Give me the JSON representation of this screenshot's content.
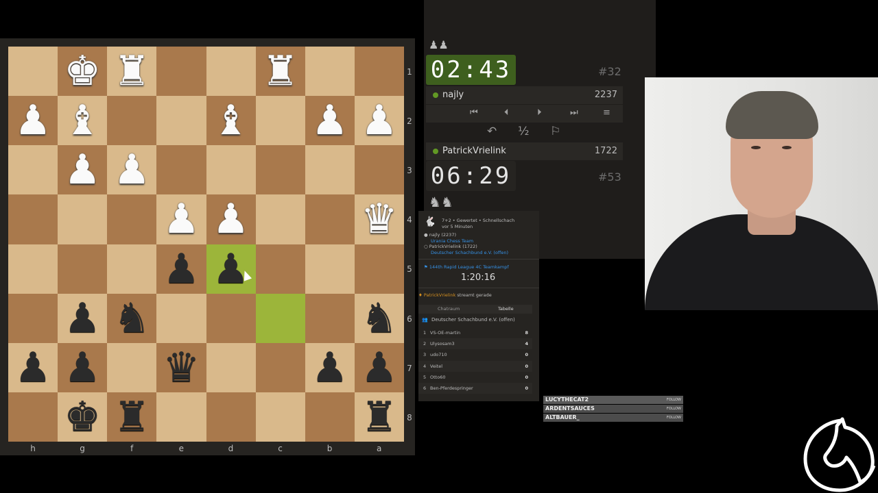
{
  "board": {
    "ranks": [
      "1",
      "2",
      "3",
      "4",
      "5",
      "6",
      "7",
      "8"
    ],
    "files": [
      "h",
      "g",
      "f",
      "e",
      "d",
      "c",
      "b",
      "a"
    ],
    "squares": [
      [
        "",
        "♚",
        "♜",
        "",
        "",
        "♜",
        "",
        ""
      ],
      [
        "♟",
        "♝",
        "",
        "",
        "♝",
        "",
        "♟",
        "♟"
      ],
      [
        "",
        "♟",
        "♟",
        "",
        "",
        "",
        "",
        ""
      ],
      [
        "",
        "",
        "",
        "♟",
        "♟",
        "",
        "",
        "♛"
      ],
      [
        "",
        "",
        "",
        "♟",
        "♟",
        "",
        "",
        ""
      ],
      [
        "",
        "♟",
        "♞",
        "",
        "",
        "",
        "",
        "♞"
      ],
      [
        "♟",
        "♟",
        "",
        "♛",
        "",
        "",
        "♟",
        "♟"
      ],
      [
        "",
        "♚",
        "♜",
        "",
        "",
        "",
        "",
        "♜"
      ]
    ],
    "colors": [
      [
        "",
        "w",
        "w",
        "",
        "",
        "w",
        "",
        ""
      ],
      [
        "w",
        "w",
        "",
        "",
        "w",
        "",
        "w",
        "w"
      ],
      [
        "",
        "w",
        "w",
        "",
        "",
        "",
        "",
        ""
      ],
      [
        "",
        "",
        "",
        "w",
        "w",
        "",
        "",
        "w"
      ],
      [
        "",
        "",
        "",
        "b",
        "b",
        "",
        "",
        ""
      ],
      [
        "",
        "b",
        "b",
        "",
        "",
        "",
        "",
        "b"
      ],
      [
        "b",
        "b",
        "",
        "b",
        "",
        "",
        "b",
        "b"
      ],
      [
        "",
        "b",
        "b",
        "",
        "",
        "",
        "",
        "b"
      ]
    ],
    "last_move": [
      [
        4,
        4
      ],
      [
        5,
        5
      ]
    ]
  },
  "clock_top": {
    "time_min": "02",
    "time_sec": "43",
    "rank": "#32"
  },
  "player_top": {
    "name": "najly",
    "rating": "2237"
  },
  "player_bottom": {
    "name": "PatrickVrielink",
    "rating": "1722"
  },
  "clock_bottom": {
    "time_min": "06",
    "time_sec": "29",
    "rank": "#53"
  },
  "controls": {
    "first": "⏮",
    "prev": "⏴",
    "next": "⏵",
    "last": "⏭",
    "menu": "≡"
  },
  "actions": {
    "takeback": "↶",
    "draw": "½",
    "resign": "⚐"
  },
  "info": {
    "game_type": "7+2 • Gewertet • Schnellschach",
    "ago": "vor 5 Minuten",
    "white_player": "najly (2237)",
    "white_team": "Urania Chess Team",
    "black_player": "PatrickVrielink (1722)",
    "black_team": "Deutscher Schachbund e.V. (offen)",
    "tournament": "144th Rapid League 4C Teamkampf",
    "tournament_time": "1:20:16",
    "streamer": "PatrickVrielink",
    "streamer_suffix": "streamt gerade",
    "tab_chat": "Chatraum",
    "tab_table": "Tabelle",
    "team_name": "Deutscher Schachbund e.V. (offen)"
  },
  "leaderboard": [
    {
      "n": "1",
      "name": "VS-OE-martin",
      "pts": "8"
    },
    {
      "n": "2",
      "name": "Ulysosam3",
      "pts": "4"
    },
    {
      "n": "3",
      "name": "udo710",
      "pts": "0"
    },
    {
      "n": "4",
      "name": "Veitel",
      "pts": "0"
    },
    {
      "n": "5",
      "name": "Otto60",
      "pts": "0"
    },
    {
      "n": "6",
      "name": "Ben-Pferdespringer",
      "pts": "0"
    }
  ],
  "follows": [
    {
      "user": "LUCYTHECAT2",
      "label": "FOLLOW"
    },
    {
      "user": "ARDENTSAUCES",
      "label": "FOLLOW"
    },
    {
      "user": "ALTBAUER_",
      "label": "FOLLOW"
    }
  ],
  "colors": {
    "accent_green": "#629924",
    "clock_active": "#3e5f1e",
    "link_blue": "#3692e7"
  }
}
